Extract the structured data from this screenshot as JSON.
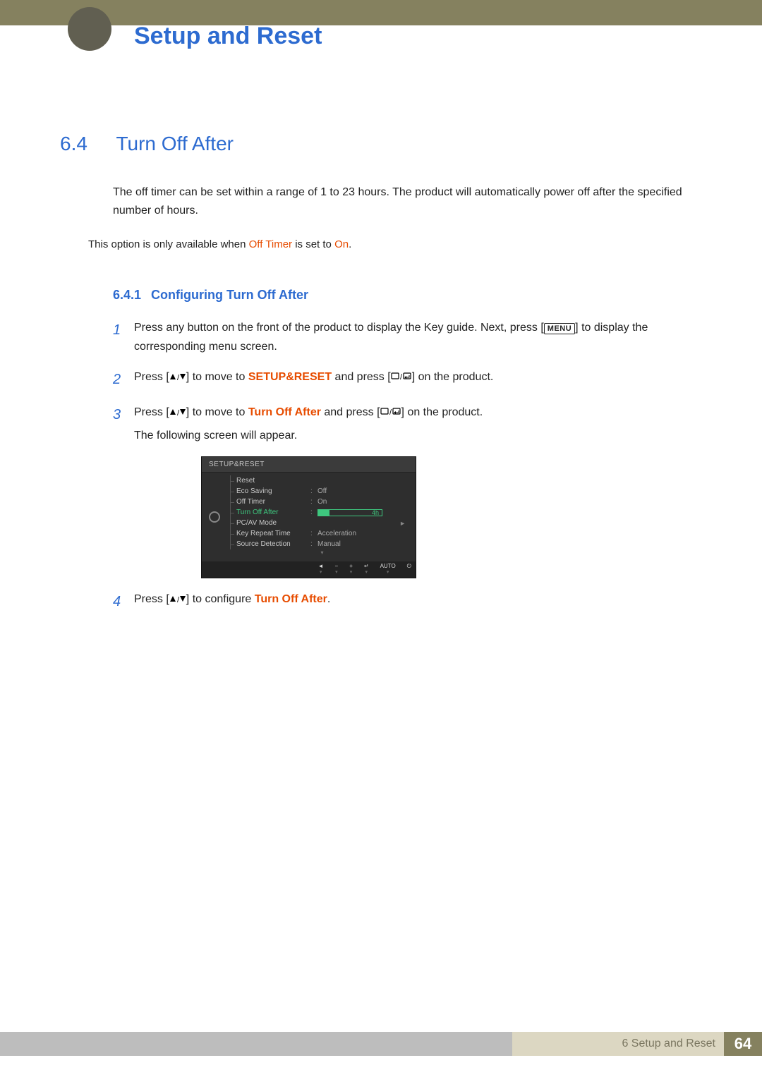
{
  "header": {
    "chapter_title": "Setup and Reset"
  },
  "section": {
    "number": "6.4",
    "title": "Turn Off After",
    "intro": "The off timer can be set within a range of 1 to 23 hours. The product will automatically power off after the specified number of hours.",
    "note_pre": "This option is only available when ",
    "note_hl1": "Off Timer",
    "note_mid": " is set to ",
    "note_hl2": "On",
    "note_end": "."
  },
  "subsection": {
    "number": "6.4.1",
    "title": "Configuring Turn Off After"
  },
  "steps": {
    "s1": {
      "n": "1",
      "pre": "Press any button on the front of the product to display the Key guide. Next, press [",
      "menu": "MENU",
      "post": "] to display the corresponding menu screen."
    },
    "s2": {
      "n": "2",
      "pre": "Press [",
      "mid1": "] to move to ",
      "hl": "SETUP&RESET",
      "mid2": " and press [",
      "post": "] on the product."
    },
    "s3": {
      "n": "3",
      "pre": "Press [",
      "mid1": "] to move to ",
      "hl": "Turn Off After",
      "mid2": " and press [",
      "post": "] on the product.",
      "tail": "The following screen will appear."
    },
    "s4": {
      "n": "4",
      "pre": "Press [",
      "mid": "] to configure ",
      "hl": "Turn Off After",
      "end": "."
    }
  },
  "osd": {
    "title": "SETUP&RESET",
    "rows": [
      {
        "label": "Reset",
        "value": ""
      },
      {
        "label": "Eco Saving",
        "value": "Off"
      },
      {
        "label": "Off Timer",
        "value": "On"
      },
      {
        "label": "Turn Off After",
        "value": "4h",
        "selected": true,
        "slider": true
      },
      {
        "label": "PC/AV Mode",
        "value": ""
      },
      {
        "label": "Key Repeat Time",
        "value": "Acceleration"
      },
      {
        "label": "Source Detection",
        "value": "Manual"
      }
    ],
    "footer": [
      "◄",
      "−",
      "+",
      "↵",
      "AUTO",
      "⏻"
    ]
  },
  "footer": {
    "breadcrumb": "6 Setup and Reset",
    "page": "64"
  }
}
